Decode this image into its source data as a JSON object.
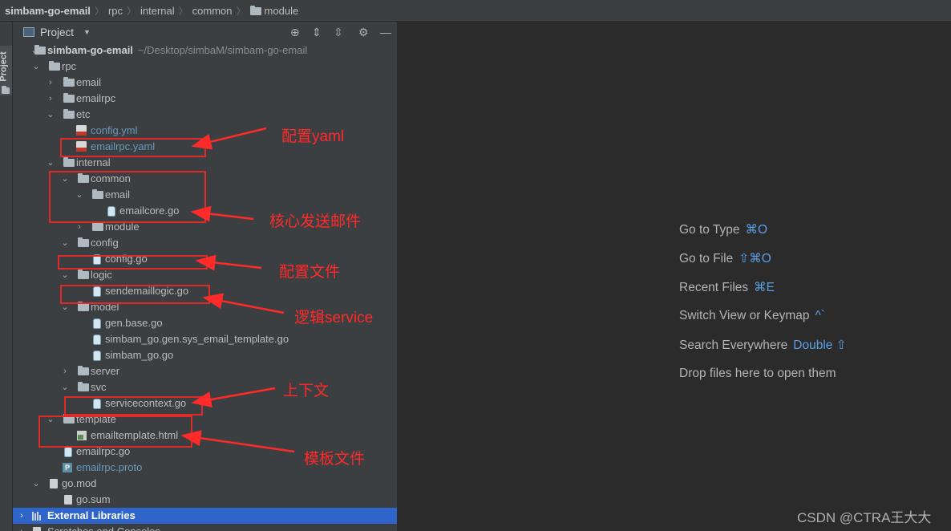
{
  "breadcrumb": {
    "project": "simbam-go-email",
    "items": [
      "rpc",
      "internal",
      "common",
      "module"
    ]
  },
  "sidebar_tab": {
    "label": "Project"
  },
  "panel": {
    "title": "Project"
  },
  "tree": {
    "root": {
      "name": "simbam-go-email",
      "path": "~/Desktop/simbaM/simbam-go-email"
    },
    "rpc": "rpc",
    "email": "email",
    "emailrpc": "emailrpc",
    "etc": "etc",
    "config_yml": "config.yml",
    "emailrpc_yaml": "emailrpc.yaml",
    "internal": "internal",
    "common": "common",
    "common_email": "email",
    "emailcore_go": "emailcore.go",
    "module": "module",
    "config_dir": "config",
    "config_go": "config.go",
    "logic": "logic",
    "sendemaillogic_go": "sendemaillogic.go",
    "model": "model",
    "gen_base_go": "gen.base.go",
    "gen_sys_email_template_go": "simbam_go.gen.sys_email_template.go",
    "simbam_go_go": "simbam_go.go",
    "server": "server",
    "svc": "svc",
    "servicecontext_go": "servicecontext.go",
    "template": "template",
    "emailtemplate_html": "emailtemplate.html",
    "emailrpc_go": "emailrpc.go",
    "emailrpc_proto": "emailrpc.proto",
    "go_mod": "go.mod",
    "go_sum": "go.sum",
    "external_libraries": "External Libraries",
    "scratches": "Scratches and Consoles"
  },
  "hints": [
    {
      "label": "Go to Type",
      "shortcut": "⌘O"
    },
    {
      "label": "Go to File",
      "shortcut": "⇧⌘O"
    },
    {
      "label": "Recent Files",
      "shortcut": "⌘E"
    },
    {
      "label": "Switch View or Keymap",
      "shortcut": "^`"
    },
    {
      "label": "Search Everywhere",
      "shortcut": "Double ⇧"
    },
    {
      "label": "Drop files here to open them",
      "shortcut": ""
    }
  ],
  "annotations": {
    "yaml": "配置yaml",
    "core": "核心发送邮件",
    "config": "配置文件",
    "logic": "逻辑service",
    "context": "上下文",
    "template": "模板文件"
  },
  "watermark": "CSDN @CTRA王大大",
  "colors": {
    "annotation": "#ff2a2a",
    "selection": "#2f65ca",
    "shortcut": "#5c9fe3"
  }
}
